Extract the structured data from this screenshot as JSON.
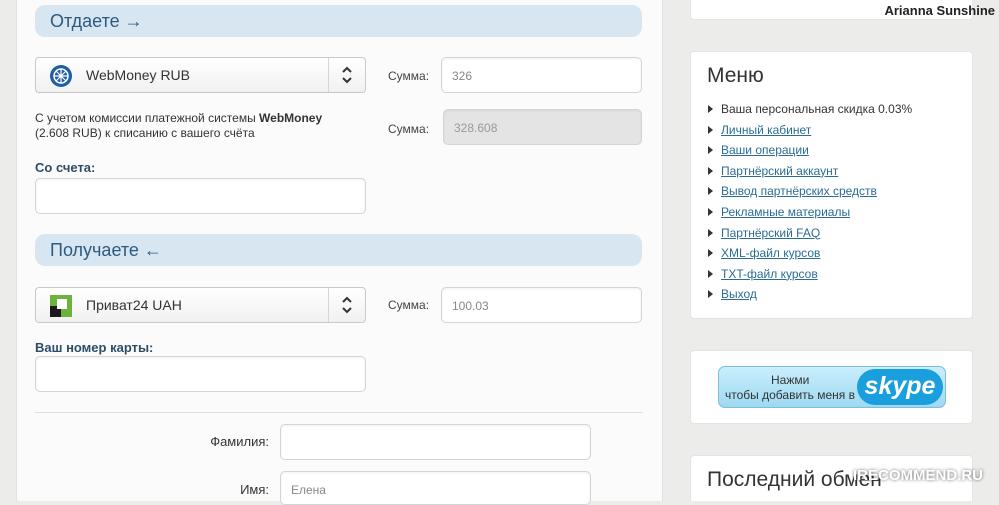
{
  "give": {
    "header": "Отдаете →",
    "currency": "WebMoney RUB",
    "amount_label": "Сумма:",
    "amount_value": "326",
    "fee_note_prefix": "С учетом комиссии платежной системы ",
    "fee_note_system": "WebMoney",
    "fee_note_suffix": "(2.608 RUB) к списанию с вашего счёта",
    "total_label": "Сумма:",
    "total_value": "328.608",
    "account_label": "Со счета:",
    "account_value": ""
  },
  "receive": {
    "header": "Получаете ←",
    "currency": "Приват24 UAH",
    "amount_label": "Сумма:",
    "amount_value": "100.03",
    "card_label": "Ваш номер карты:",
    "card_value": ""
  },
  "personal": {
    "surname_label": "Фамилия:",
    "surname_value": "",
    "name_label": "Имя:",
    "name_value": "Елена"
  },
  "user": {
    "name": "Arianna Sunshine"
  },
  "menu": {
    "title": "Меню",
    "items": [
      {
        "label": "Ваша персональная скидка 0.03%"
      },
      {
        "label": "Личный кабинет"
      },
      {
        "label": "Ваши операции"
      },
      {
        "label": "Партнёрский аккаунт"
      },
      {
        "label": "Вывод партнёрских средств"
      },
      {
        "label": "Рекламные материалы"
      },
      {
        "label": "Партнёрский FAQ"
      },
      {
        "label": "XML-файл курсов"
      },
      {
        "label": "TXT-файл курсов"
      },
      {
        "label": "Выход"
      }
    ]
  },
  "skype": {
    "line1": "Нажми",
    "line2": "чтобы добавить меня в",
    "logo": "skype"
  },
  "last_exchange": {
    "title": "Последний обмен"
  },
  "watermark": "IRECOMMEND.RU",
  "colors": {
    "section_header_bg": "#d7e6f1",
    "section_header_text": "#2c5a80",
    "link": "#2a6c96",
    "label_bold": "#2d4d67",
    "skype_blue": "#1a9fde"
  },
  "icons": {
    "webmoney": "webmoney-globe-icon",
    "privat24": "privat24-icon",
    "select_arrows": "up-down-chevron-icon"
  }
}
